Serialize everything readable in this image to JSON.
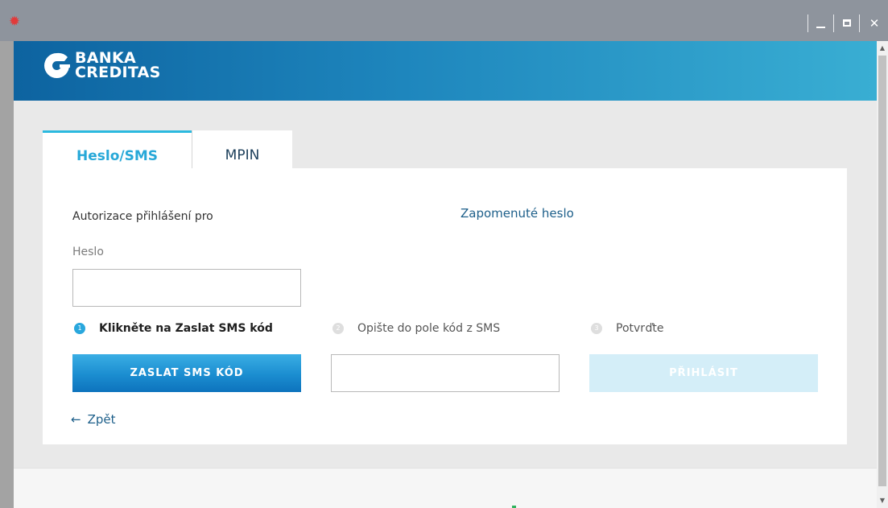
{
  "window": {
    "app_icon": "sun-icon",
    "controls": [
      "minimize-icon",
      "maximize-icon",
      "close-icon"
    ],
    "close_glyph": "✕"
  },
  "brand": {
    "name_line1": "BANKA",
    "name_line2": "CREDITAS",
    "colors": {
      "header_start": "#0d63a0",
      "header_end": "#39aed3",
      "accent": "#29a7dd"
    }
  },
  "tabs": [
    {
      "label": "Heslo/SMS",
      "active": true
    },
    {
      "label": "MPIN",
      "active": false
    }
  ],
  "form": {
    "auth_label": "Autorizace přihlášení pro",
    "forgot_password": "Zapomenuté heslo",
    "password_label": "Heslo",
    "password_value": "",
    "sms_code_value": "",
    "steps": [
      {
        "number": "1",
        "text": "Klikněte na Zaslat SMS kód",
        "active": true
      },
      {
        "number": "2",
        "text": "Opište do pole kód z SMS",
        "active": false
      },
      {
        "number": "3",
        "text": "Potvrďte",
        "active": false
      }
    ],
    "send_sms_button": "ZASLAT SMS KÓD",
    "login_button": "PŘIHLÁSIT",
    "back_link": "Zpět"
  }
}
